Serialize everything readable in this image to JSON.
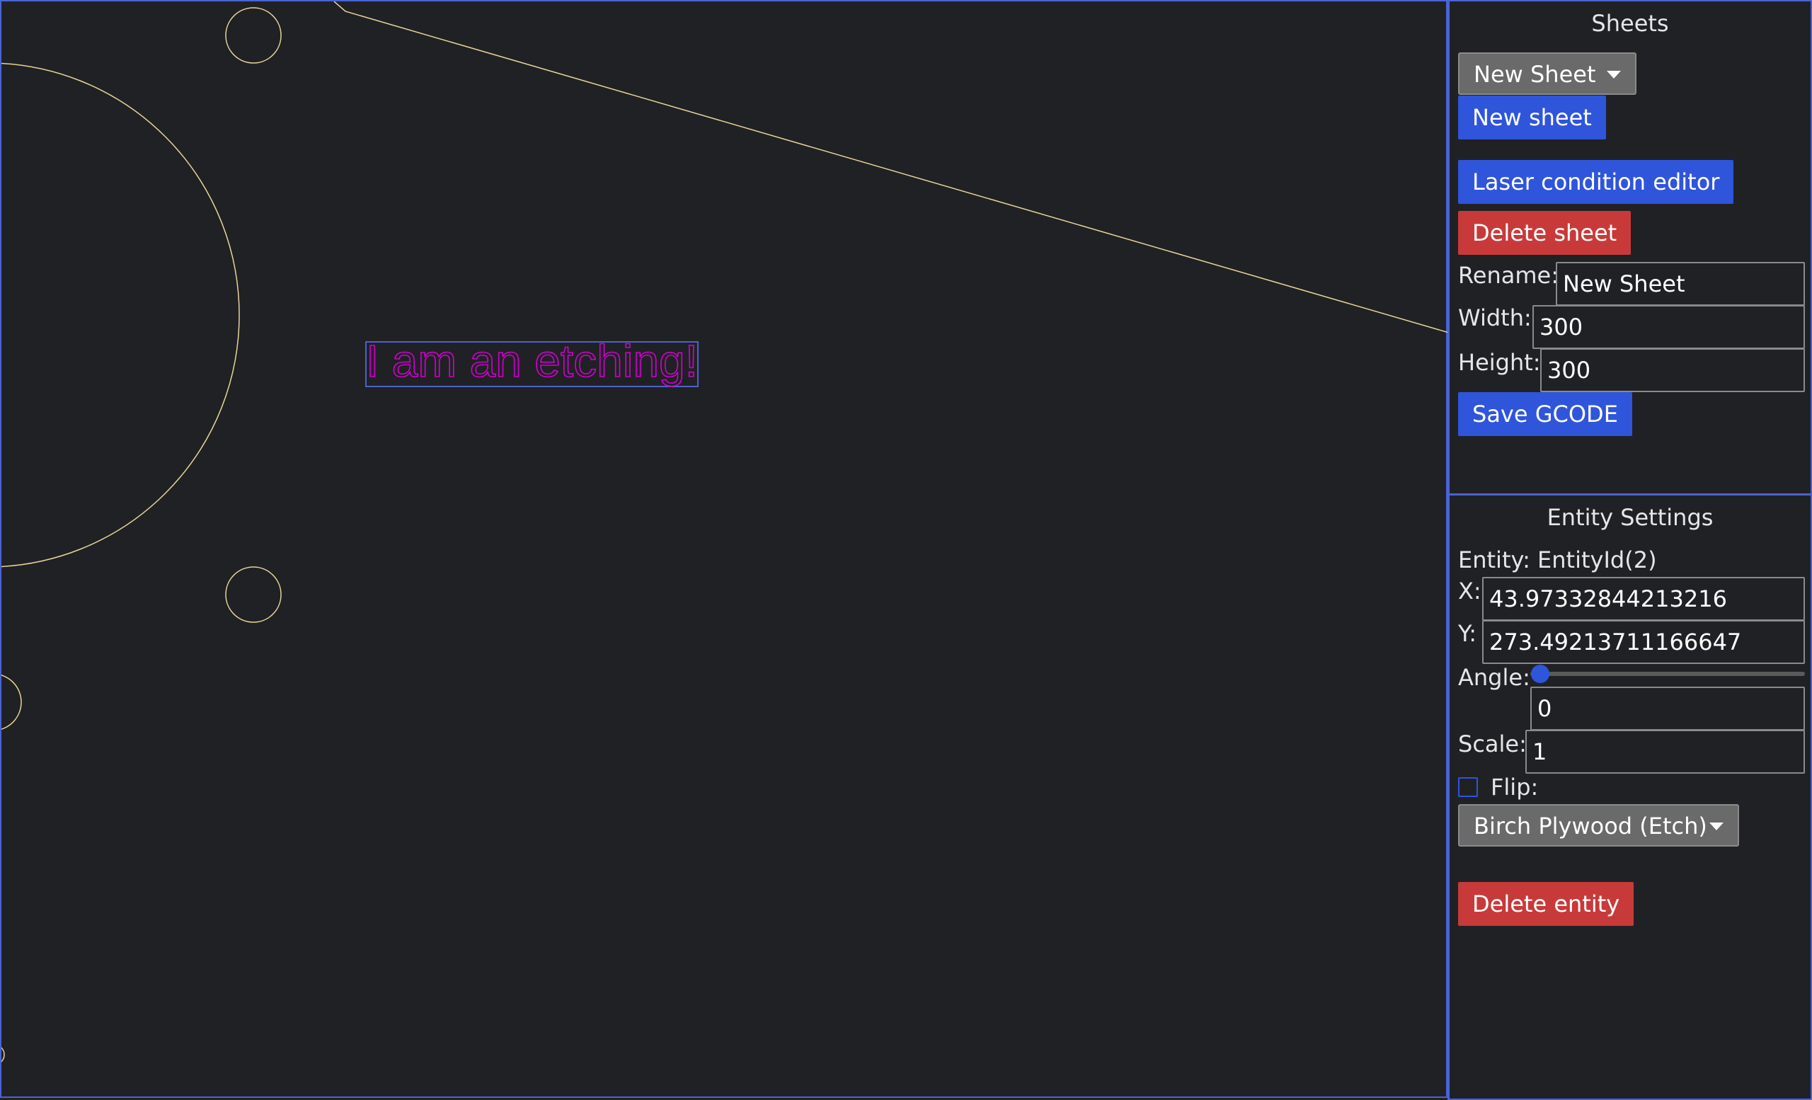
{
  "canvas": {
    "etching_text": "I am an etching!",
    "colors": {
      "cut_line": "#e8d49a",
      "etch": "#d000d0",
      "selection": "#5a78ff"
    }
  },
  "sheets": {
    "title": "Sheets",
    "selected_sheet": "New Sheet",
    "new_sheet_label": "New sheet",
    "laser_editor_label": "Laser condition editor",
    "delete_sheet_label": "Delete sheet",
    "rename_label": "Rename:",
    "rename_value": "New Sheet",
    "width_label": "Width:",
    "width_value": "300",
    "height_label": "Height:",
    "height_value": "300",
    "save_gcode_label": "Save GCODE"
  },
  "entity": {
    "title": "Entity Settings",
    "entity_label": "Entity: EntityId(2)",
    "x_label": "X:",
    "x_value": "43.97332844213216",
    "y_label": "Y:",
    "y_value": "273.49213711166647",
    "angle_label": "Angle:",
    "angle_value": "0",
    "angle_slider_fraction": 0,
    "scale_label": "Scale:",
    "scale_value": "1",
    "flip_label": "Flip:",
    "flip_checked": false,
    "material": "Birch Plywood (Etch)",
    "delete_entity_label": "Delete entity"
  },
  "theme": {
    "accent": "#2f55db",
    "danger": "#c83a3a",
    "border": "#4a63d6",
    "background": "#202124"
  }
}
